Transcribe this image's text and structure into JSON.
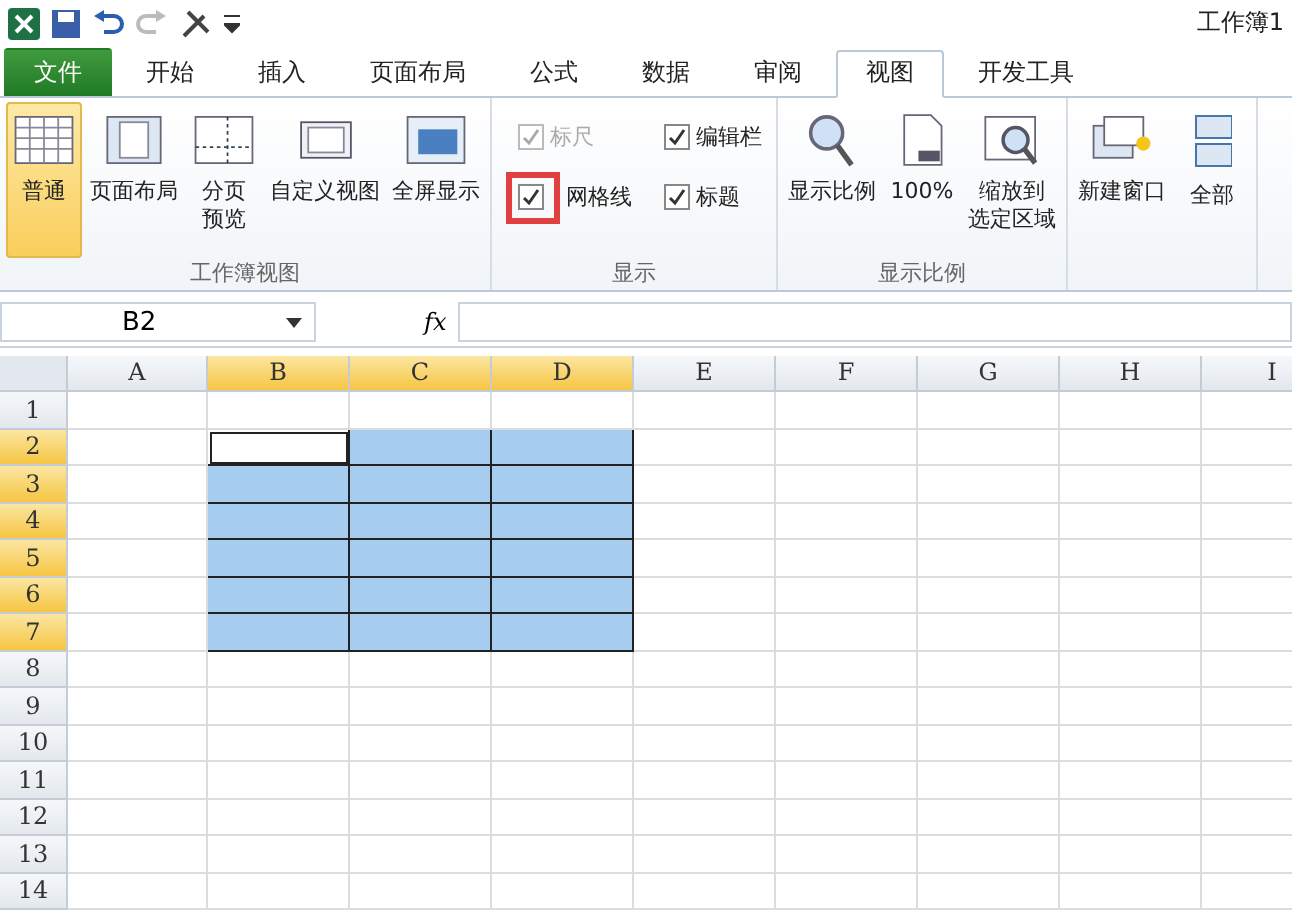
{
  "title_bar": {
    "title": "工作簿1"
  },
  "tabs": [
    {
      "label": "文件",
      "kind": "file",
      "selected": false
    },
    {
      "label": "开始",
      "kind": "tab",
      "selected": false
    },
    {
      "label": "插入",
      "kind": "tab",
      "selected": false
    },
    {
      "label": "页面布局",
      "kind": "tab",
      "selected": false
    },
    {
      "label": "公式",
      "kind": "tab",
      "selected": false
    },
    {
      "label": "数据",
      "kind": "tab",
      "selected": false
    },
    {
      "label": "审阅",
      "kind": "tab",
      "selected": false
    },
    {
      "label": "视图",
      "kind": "tab",
      "selected": true
    },
    {
      "label": "开发工具",
      "kind": "tab",
      "selected": false
    }
  ],
  "ribbon_groups": [
    {
      "label": "工作簿视图",
      "items": [
        {
          "kind": "large",
          "label": [
            "普通"
          ],
          "selected": true
        },
        {
          "kind": "large",
          "label": [
            "页面布局"
          ],
          "selected": false
        },
        {
          "kind": "large",
          "label": [
            "分页",
            "预览"
          ],
          "selected": false
        },
        {
          "kind": "large",
          "label": [
            "自定义视图"
          ],
          "selected": false
        },
        {
          "kind": "large",
          "label": [
            "全屏显示"
          ],
          "selected": false
        }
      ]
    },
    {
      "label": "显示",
      "items": [
        {
          "kind": "checkbox",
          "label": "标尺",
          "checked": true,
          "disabled": true
        },
        {
          "kind": "checkbox",
          "label": "网格线",
          "checked": true,
          "disabled": false,
          "highlighted": true
        },
        {
          "kind": "checkbox",
          "label": "编辑栏",
          "checked": true,
          "disabled": false
        },
        {
          "kind": "checkbox",
          "label": "标题",
          "checked": true,
          "disabled": false
        }
      ]
    },
    {
      "label": "显示比例",
      "items": [
        {
          "kind": "large",
          "label": [
            "显示比例"
          ],
          "selected": false
        },
        {
          "kind": "large",
          "label": [
            "100%"
          ],
          "selected": false
        },
        {
          "kind": "large",
          "label": [
            "缩放到",
            "选定区域"
          ],
          "selected": false
        }
      ]
    },
    {
      "items": [
        {
          "kind": "large",
          "label": [
            "新建窗口"
          ],
          "selected": false
        },
        {
          "kind": "large",
          "label": [
            "全部"
          ],
          "selected": false
        }
      ]
    }
  ],
  "formula_bar": {
    "name_box": "B2",
    "fx": "fx"
  },
  "columns": [
    {
      "label": "A",
      "selected": false
    },
    {
      "label": "B",
      "selected": true
    },
    {
      "label": "C",
      "selected": true
    },
    {
      "label": "D",
      "selected": true
    },
    {
      "label": "E",
      "selected": false
    },
    {
      "label": "F",
      "selected": false
    },
    {
      "label": "G",
      "selected": false
    },
    {
      "label": "H",
      "selected": false
    },
    {
      "label": "I",
      "selected": false
    }
  ],
  "rows": [
    {
      "label": "1",
      "selected": false
    },
    {
      "label": "2",
      "selected": true
    },
    {
      "label": "3",
      "selected": true
    },
    {
      "label": "4",
      "selected": true
    },
    {
      "label": "5",
      "selected": true
    },
    {
      "label": "6",
      "selected": true
    },
    {
      "label": "7",
      "selected": true
    },
    {
      "label": "8",
      "selected": false
    },
    {
      "label": "9",
      "selected": false
    },
    {
      "label": "10",
      "selected": false
    },
    {
      "label": "11",
      "selected": false
    },
    {
      "label": "12",
      "selected": false
    },
    {
      "label": "13",
      "selected": false
    },
    {
      "label": "14",
      "selected": false
    }
  ]
}
